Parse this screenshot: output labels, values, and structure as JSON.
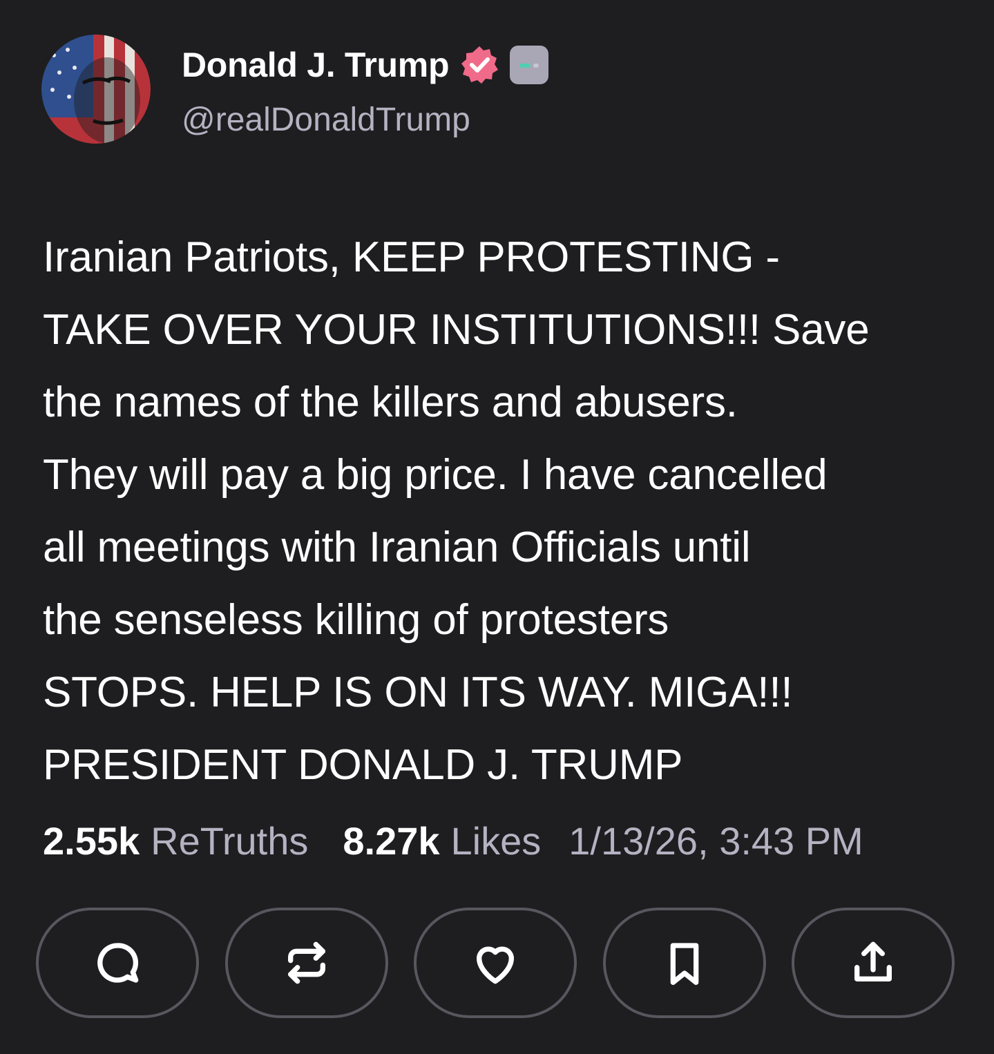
{
  "author": {
    "display_name": "Donald J. Trump",
    "handle": "@realDonaldTrump",
    "avatar_icon": "avatar-flag-portrait",
    "verified_badge_color": "#f06a8a",
    "tier_badge_color": "#a9a6b6"
  },
  "post": {
    "lines": [
      "Iranian Patriots, KEEP PROTESTING -",
      "TAKE OVER YOUR INSTITUTIONS!!! Save",
      "the names of the killers and abusers.",
      "They will pay a big price. I have cancelled",
      "all meetings with Iranian Officials until",
      "the senseless killing of protesters",
      "STOPS. HELP IS ON ITS WAY. MIGA!!!",
      "PRESIDENT DONALD J. TRUMP"
    ]
  },
  "stats": {
    "retruths_count": "2.55k",
    "retruths_label": "ReTruths",
    "likes_count": "8.27k",
    "likes_label": "Likes",
    "timestamp": "1/13/26, 3:43 PM"
  },
  "actions": [
    {
      "icon": "reply-icon"
    },
    {
      "icon": "retruth-icon"
    },
    {
      "icon": "like-icon"
    },
    {
      "icon": "bookmark-icon"
    },
    {
      "icon": "share-icon"
    }
  ],
  "colors": {
    "background": "#1e1e20",
    "text": "#ffffff",
    "muted": "#b5b2c2",
    "button_border": "#58565e"
  }
}
